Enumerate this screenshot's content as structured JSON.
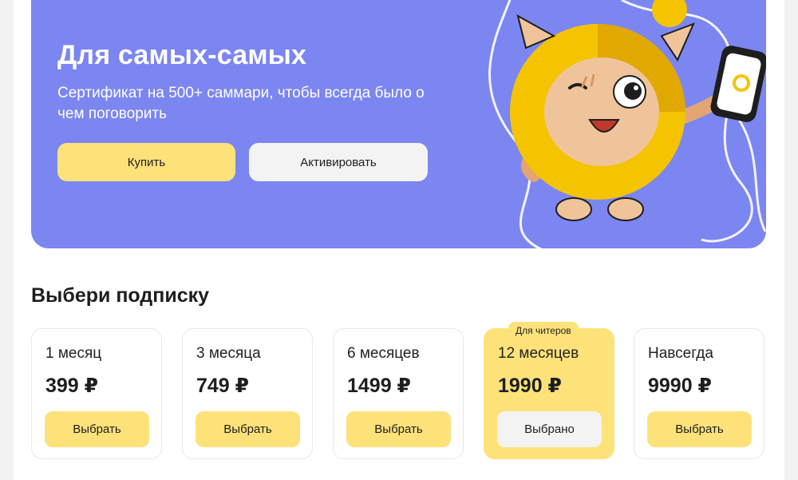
{
  "hero": {
    "title": "Для самых-самых",
    "subtitle": "Сертификат на 500+ саммари, чтобы всегда было о чем поговорить",
    "buy_label": "Купить",
    "activate_label": "Активировать",
    "background": "#7b86f0"
  },
  "subscriptions": {
    "title": "Выбери подписку",
    "plans": [
      {
        "period": "1 месяц",
        "price": "399 ₽",
        "button": "Выбрать",
        "selected": false
      },
      {
        "period": "3 месяца",
        "price": "749 ₽",
        "button": "Выбрать",
        "selected": false
      },
      {
        "period": "6 месяцев",
        "price": "1499 ₽",
        "button": "Выбрать",
        "selected": false
      },
      {
        "period": "12 месяцев",
        "price": "1990 ₽",
        "button": "Выбрано",
        "selected": true,
        "badge": "Для читеров"
      },
      {
        "period": "Навсегда",
        "price": "9990 ₽",
        "button": "Выбрать",
        "selected": false
      }
    ]
  },
  "colors": {
    "accent": "#fde27a",
    "hero": "#7b86f0"
  }
}
